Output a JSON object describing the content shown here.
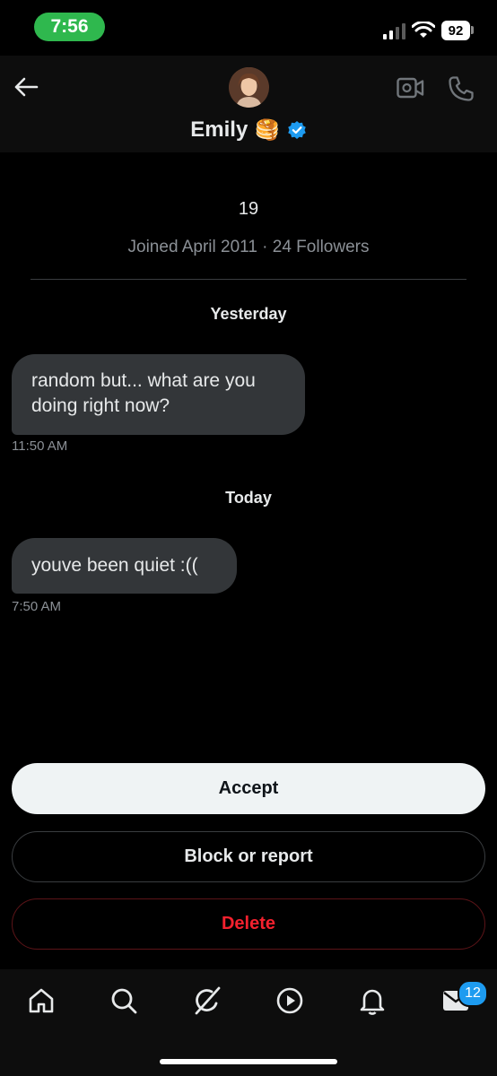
{
  "status_bar": {
    "time": "7:56",
    "battery": "92"
  },
  "header": {
    "name": "Emily",
    "name_emoji": "🥞"
  },
  "profile": {
    "age": "19",
    "joined": "Joined April 2011 · 24 Followers"
  },
  "conversation": {
    "groups": [
      {
        "day": "Yesterday",
        "text": "random but... what are you doing right now?",
        "time": "11:50 AM"
      },
      {
        "day": "Today",
        "text": "youve been quiet :((",
        "time": "7:50 AM"
      }
    ]
  },
  "actions": {
    "accept": "Accept",
    "block": "Block or report",
    "delete": "Delete"
  },
  "bottom_nav": {
    "items": [
      "home-icon",
      "search-icon",
      "grok-icon",
      "video-icon",
      "bell-icon",
      "mail-icon"
    ],
    "messages_badge": "12"
  },
  "colors": {
    "accent": "#1d9bf0",
    "danger": "#f4212e",
    "bubble": "#333639",
    "status_green": "#2fb84e"
  }
}
